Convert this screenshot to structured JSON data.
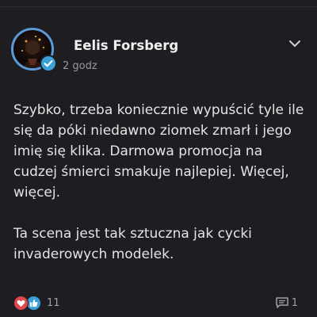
{
  "post": {
    "author": "Eelis Forsberg",
    "time": "2 godz",
    "verified": true,
    "paragraphs": [
      "Szybko, trzeba koniecznie wypuścić tyle ile się da póki niedawno ziomek zmarł i jego imię się klika. Darmowa promocja na cudzej śmierci smakuje najlepiej. Więcej, więcej.",
      "Ta scena jest tak sztuczna jak cycki invaderowych modelek."
    ],
    "reactions": {
      "icons": [
        "heart-icon",
        "thumbs-up-icon"
      ],
      "count": "11"
    },
    "comments": {
      "icon": "comment-icon",
      "count": "1"
    }
  },
  "colors": {
    "background": "#1e1e22",
    "accent_blue": "#3aa0d8",
    "heart_red": "#e0484f",
    "text": "#e4e4e4",
    "muted": "#9a9a9e"
  }
}
